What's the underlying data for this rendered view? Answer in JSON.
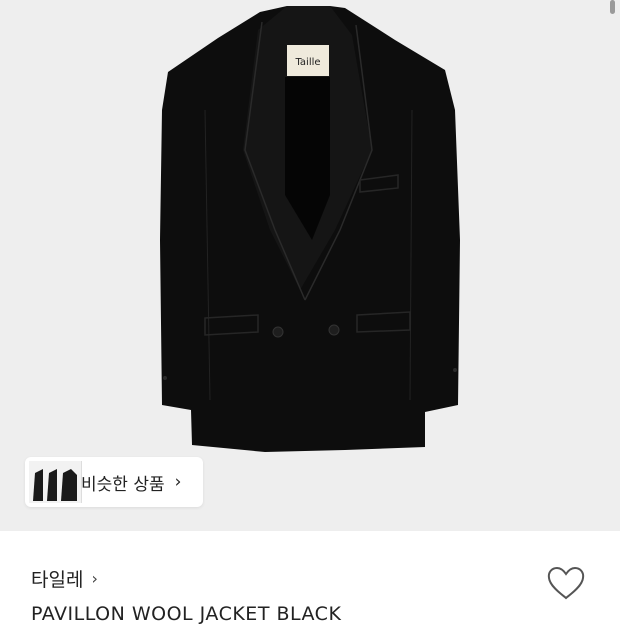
{
  "product_image": {
    "label_text": "Taille"
  },
  "similar": {
    "label": "비슷한 상품",
    "arrow": "›"
  },
  "brand": {
    "name": "타일레",
    "arrow": "›"
  },
  "product": {
    "title": "PAVILLON WOOL JACKET BLACK"
  },
  "icons": {
    "wishlist": "heart-outline-icon"
  },
  "colors": {
    "hero_bg": "#eeeeee",
    "jacket": "#0d0d0d",
    "text": "#222222"
  }
}
